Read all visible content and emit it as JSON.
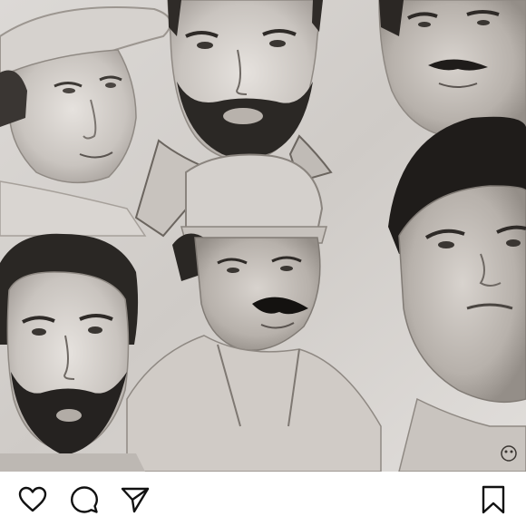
{
  "post": {
    "image_icon": "pencil-portrait-collage",
    "colors": {
      "background": "#ffffff",
      "icon_stroke": "#111111"
    }
  },
  "actions": {
    "like_icon": "heart-icon",
    "comment_icon": "comment-bubble-icon",
    "share_icon": "paper-plane-icon",
    "save_icon": "bookmark-icon"
  }
}
